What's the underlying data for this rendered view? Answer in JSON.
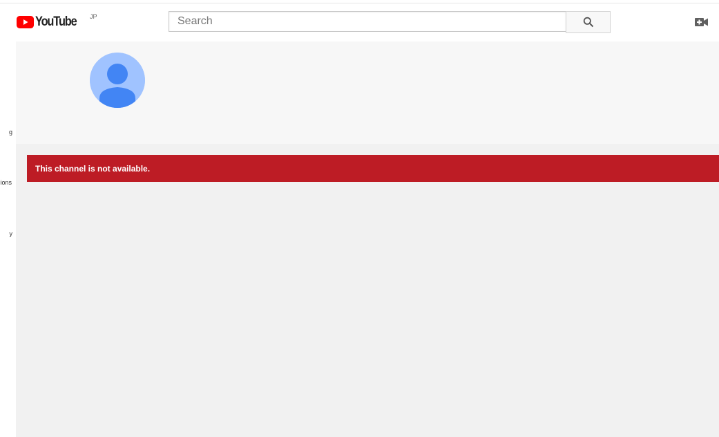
{
  "masthead": {
    "logo_text": "YouTube",
    "country_code": "JP",
    "search": {
      "placeholder": "Search",
      "value": ""
    },
    "search_icon": "search-icon",
    "upload_icon": "video-camera-add-icon"
  },
  "sidebar": {
    "items": [
      {
        "label": "g"
      },
      {
        "label": "ions"
      },
      {
        "label": "y"
      }
    ]
  },
  "channel": {
    "avatar_icon": "default-avatar-icon"
  },
  "alert": {
    "message": "This channel is not available.",
    "color": "#bd1c25"
  },
  "colors": {
    "brand_red": "#ff0000",
    "header_bg": "#f7f7f7",
    "content_bg": "#f1f1f1",
    "avatar_bg": "#a0c3ff",
    "avatar_fg": "#4285f4"
  }
}
